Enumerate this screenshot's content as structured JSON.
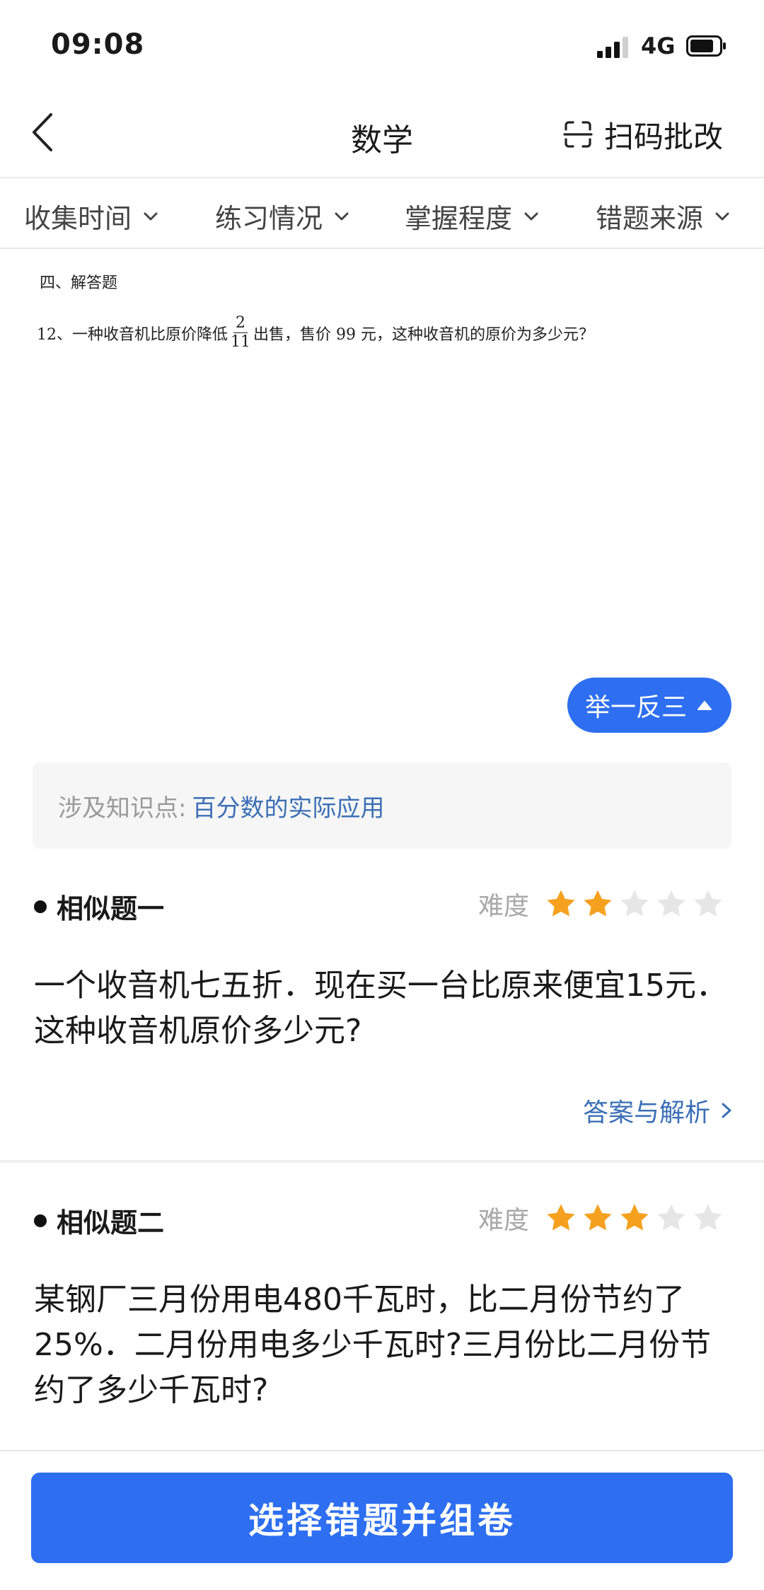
{
  "status_bar": {
    "time": "09:08",
    "network": "4G"
  },
  "nav": {
    "title": "数学",
    "scan_label": "扫码批改"
  },
  "filters": [
    {
      "label": "收集时间"
    },
    {
      "label": "练习情况"
    },
    {
      "label": "掌握程度"
    },
    {
      "label": "错题来源"
    }
  ],
  "question": {
    "section": "四、解答题",
    "prefix": "12、一种收音机比原价降低",
    "fraction_num": "2",
    "fraction_den": "11",
    "suffix": "出售，售价 99 元，这种收音机的原价为多少元？"
  },
  "jyfs_label": "举一反三",
  "knowledge": {
    "label": "涉及知识点:",
    "value": "百分数的实际应用"
  },
  "similar": [
    {
      "title": "相似题一",
      "difficulty_label": "难度",
      "stars_filled": 2,
      "stars_total": 5,
      "text": "一个收音机七五折．现在买一台比原来便宜15元．这种收音机原价多少元?",
      "answer_link": "答案与解析"
    },
    {
      "title": "相似题二",
      "difficulty_label": "难度",
      "stars_filled": 3,
      "stars_total": 5,
      "text": "某钢厂三月份用电480千瓦时，比二月份节约了25%．二月份用电多少千瓦时?三月份比二月份节约了多少千瓦时?"
    }
  ],
  "bottom_button": "选择错题并组卷",
  "colors": {
    "primary": "#2d6ff0",
    "star_filled": "#f5a11f",
    "star_empty": "#e6e6e6",
    "link": "#3b6fb6"
  }
}
